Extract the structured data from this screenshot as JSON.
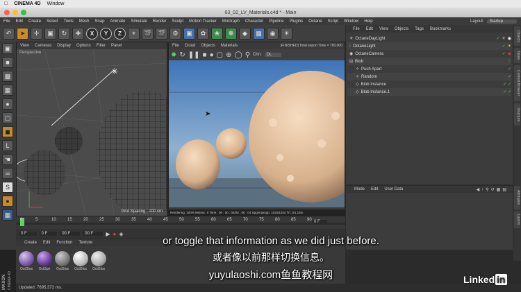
{
  "macbar": {
    "app": "CINEMA 4D",
    "items": [
      "Window"
    ]
  },
  "window": {
    "title": "03_02_LV_Materials.c4d * - Main"
  },
  "menubar": [
    "File",
    "Edit",
    "Create",
    "Select",
    "Tools",
    "Mesh",
    "Snap",
    "Animate",
    "Simulate",
    "Render",
    "Sculpt",
    "Motion Tracker",
    "MoGraph",
    "Character",
    "Pipeline",
    "Plugins",
    "Octane",
    "Script",
    "Window",
    "Help"
  ],
  "layout": {
    "label": "Layout:",
    "value": "Startup"
  },
  "viewport": {
    "menu": [
      "View",
      "Cameras",
      "Display",
      "Options",
      "Filter",
      "Panel"
    ],
    "label": "Perspective",
    "grid_spacing": "Grid Spacing : 100 cm"
  },
  "octane": {
    "menu": [
      "File",
      "Cloud",
      "Objects",
      "Materials"
    ],
    "status": "[FINISHED] Total export Time = 700.000",
    "channel_label": "Chn:",
    "channel_value": "DL",
    "info": "Rendering: 100%  Ms/sec: 0  Time : 00 : 00 : 04/00 : 00 : 04  Spp/maxspp: 1024/1024  Tri: 0/1.16m"
  },
  "object_manager": {
    "menu": [
      "File",
      "Edit",
      "View",
      "Objects",
      "Tags",
      "Bookmarks"
    ],
    "items": [
      "OctaneDayLight",
      "OctaneLight",
      "OctaneCamera",
      "Blob",
      "Push Apart",
      "Random",
      "Blob Instance",
      "Blob Instance.1"
    ]
  },
  "attribute_manager": {
    "menu": [
      "Mode",
      "Edit",
      "User Data"
    ]
  },
  "right_tabs": [
    "Objects",
    "Takes",
    "Content Browser",
    "Structure",
    "Attributes",
    "Layers"
  ],
  "timeline": {
    "ticks": [
      "0",
      "5",
      "10",
      "15",
      "20",
      "25",
      "30",
      "35",
      "40",
      "45",
      "50",
      "55",
      "60",
      "65",
      "70",
      "75",
      "80",
      "85",
      "90"
    ],
    "frame_end": "0 F"
  },
  "transport": {
    "start": "0 F",
    "mid": "0 F",
    "end": "90 F",
    "end2": "90 F"
  },
  "material_manager": {
    "menu": [
      "Create",
      "Edit",
      "Function",
      "Texture"
    ],
    "materials": [
      "OctGlos",
      "OctSpe",
      "OctGlos",
      "OctGlos",
      "OctGlos"
    ]
  },
  "status": {
    "text": "Updated: 7695.372 ms."
  },
  "maxon": {
    "line1": "MAXON",
    "line2": "CINEMA 4D"
  },
  "subtitles": {
    "en": "or toggle that information as we did just before.",
    "zh": "或者像以前那样切换信息。",
    "watermark": "yuyulaoshi.com鱼鱼教程网"
  },
  "brand": {
    "text": "Linked",
    "suffix": "in"
  },
  "colors": {
    "accent": "#c98a2a",
    "check": "#6ac16a"
  }
}
